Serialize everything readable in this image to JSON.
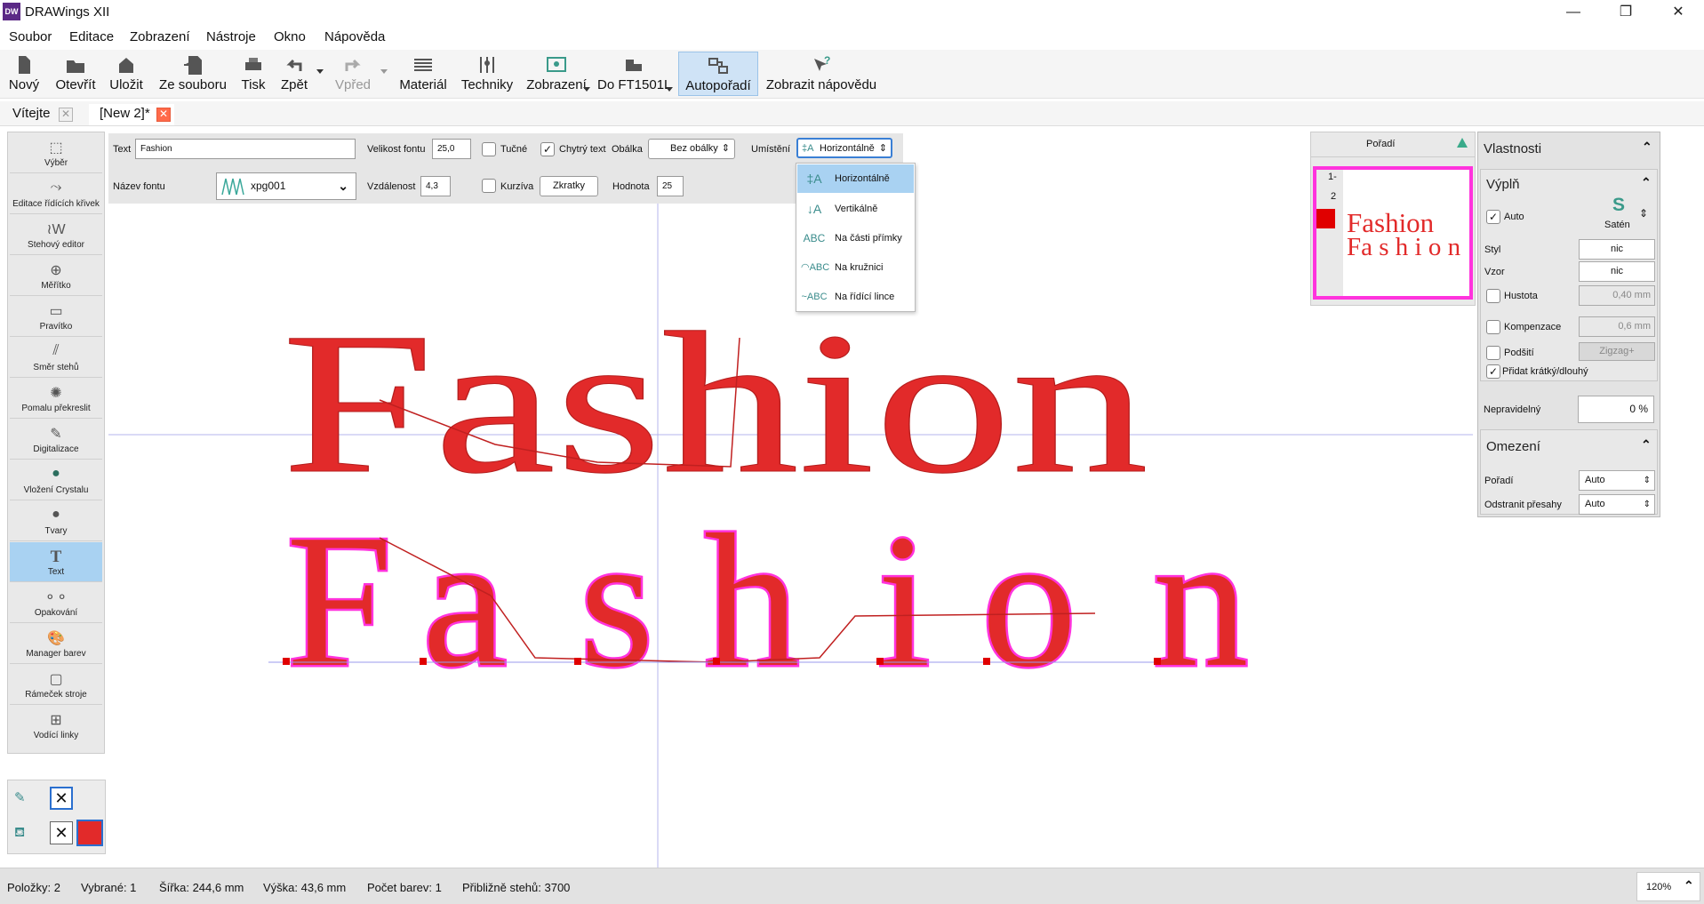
{
  "window": {
    "title": "DRAWings XII",
    "logo": "DW"
  },
  "menu": [
    "Soubor",
    "Editace",
    "Zobrazení",
    "Nástroje",
    "Okno",
    "Nápověda"
  ],
  "toolbar": [
    {
      "label": "Nový",
      "icon": "new-file-icon"
    },
    {
      "label": "Otevřít",
      "icon": "open-folder-icon"
    },
    {
      "label": "Uložit",
      "icon": "save-icon"
    },
    {
      "label": "Ze souboru",
      "icon": "import-icon"
    },
    {
      "label": "Tisk",
      "icon": "print-icon"
    },
    {
      "label": "Zpět",
      "icon": "undo-icon"
    },
    {
      "label": "Vpřed",
      "icon": "redo-icon"
    },
    {
      "label": "Materiál",
      "icon": "fabric-icon"
    },
    {
      "label": "Techniky",
      "icon": "techniques-icon"
    },
    {
      "label": "Zobrazení",
      "icon": "view-icon"
    },
    {
      "label": "Do FT1501L",
      "icon": "machine-icon"
    },
    {
      "label": "Autopořadí",
      "icon": "autosequence-icon"
    },
    {
      "label": "Zobrazit nápovědu",
      "icon": "help-icon"
    }
  ],
  "tabs": [
    {
      "label": "Vítejte",
      "closable": true
    },
    {
      "label": "[New 2]*",
      "closable": true,
      "active": true
    }
  ],
  "tools": [
    {
      "label": "Výběr",
      "icon": "select-icon"
    },
    {
      "label": "Editace řídících křivek",
      "icon": "edit-curves-icon"
    },
    {
      "label": "Stehový editor",
      "icon": "stitch-editor-icon"
    },
    {
      "label": "Měřítko",
      "icon": "zoom-icon"
    },
    {
      "label": "Pravítko",
      "icon": "ruler-icon"
    },
    {
      "label": "Směr stehů",
      "icon": "stitch-direction-icon"
    },
    {
      "label": "Pomalu překreslit",
      "icon": "slow-redraw-icon"
    },
    {
      "label": "Digitalizace",
      "icon": "digitize-icon"
    },
    {
      "label": "Vložení Crystalu",
      "icon": "crystal-icon"
    },
    {
      "label": "Tvary",
      "icon": "shapes-icon"
    },
    {
      "label": "Text",
      "icon": "text-icon",
      "active": true
    },
    {
      "label": "Opakování",
      "icon": "repeat-icon"
    },
    {
      "label": "Manager barev",
      "icon": "palette-icon"
    },
    {
      "label": "Rámeček stroje",
      "icon": "hoop-icon"
    },
    {
      "label": "Vodící linky",
      "icon": "guides-icon"
    }
  ],
  "props": {
    "text_label": "Text",
    "text_value": "Fashion",
    "font_size_label": "Velikost fontu",
    "font_size_value": "25,0",
    "bold_label": "Tučné",
    "smart_text_label": "Chytrý text",
    "envelope_label": "Obálka",
    "envelope_value": "Bez obálky",
    "placement_label": "Umístění",
    "placement_value": "Horizontálně",
    "font_name_label": "Název fontu",
    "font_name_value": "xpg001",
    "distance_label": "Vzdálenost",
    "distance_value": "4,3",
    "italic_label": "Kurzíva",
    "shortcuts_label": "Zkratky",
    "value_label": "Hodnota",
    "value_value": "25"
  },
  "placement_options": [
    {
      "label": "Horizontálně",
      "icon": "horizontal-text-icon",
      "selected": true
    },
    {
      "label": "Vertikálně",
      "icon": "vertical-text-icon"
    },
    {
      "label": "Na části přímky",
      "icon": "line-text-icon"
    },
    {
      "label": "Na kružnici",
      "icon": "circle-text-icon"
    },
    {
      "label": "Na řídící lince",
      "icon": "curve-text-icon"
    }
  ],
  "canvas": {
    "word1": "Fashion",
    "word2_letters": [
      "F",
      "a",
      "s",
      "h",
      "i",
      "o",
      "n"
    ],
    "colors": {
      "fill": "#e22a2a",
      "outline": "#ff33dd",
      "guide": "#a0a0ee"
    }
  },
  "order_panel": {
    "title": "Pořadí",
    "items": [
      "1-",
      "2"
    ],
    "preview_line1": "Fashion",
    "preview_line2": "Fa s h i o n"
  },
  "properties": {
    "title": "Vlastnosti",
    "fill_section": "Výplň",
    "auto_label": "Auto",
    "satin_label": "Satén",
    "style_label": "Styl",
    "style_value": "nic",
    "pattern_label": "Vzor",
    "pattern_value": "nic",
    "density_label": "Hustota",
    "density_value": "0,40 mm",
    "compensation_label": "Kompenzace",
    "compensation_value": "0,6 mm",
    "underlay_label": "Podšití",
    "underlay_value": "Zigzag+",
    "shortlong_label": "Přidat krátký/dlouhý",
    "irregular_label": "Nepravidelný",
    "irregular_value": "0 %",
    "limits_section": "Omezení",
    "order_label": "Pořadí",
    "order_value": "Auto",
    "trim_label": "Odstranit přesahy",
    "trim_value": "Auto"
  },
  "status": {
    "items": "Položky: 2",
    "selected": "Vybrané: 1",
    "width": "Šířka: 244,6 mm",
    "height": "Výška: 43,6 mm",
    "colors": "Počet barev: 1",
    "stitches": "Přibližně stehů: 3700",
    "zoom": "120%"
  }
}
